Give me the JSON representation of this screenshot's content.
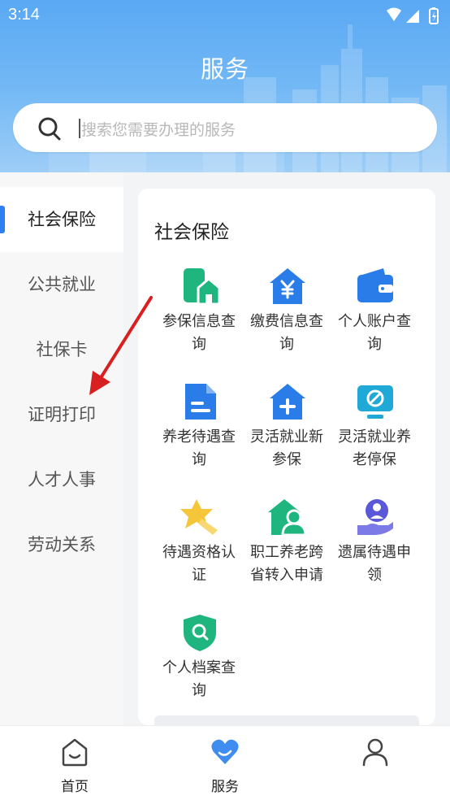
{
  "status_bar": {
    "time": "3:14"
  },
  "header": {
    "title": "服务"
  },
  "search": {
    "placeholder": "搜索您需要办理的服务"
  },
  "sidebar": {
    "items": [
      {
        "label": "社会保险",
        "active": true
      },
      {
        "label": "公共就业",
        "active": false
      },
      {
        "label": "社保卡",
        "active": false
      },
      {
        "label": "证明打印",
        "active": false
      },
      {
        "label": "人才人事",
        "active": false
      },
      {
        "label": "劳动关系",
        "active": false
      }
    ]
  },
  "content": {
    "section_title": "社会保险",
    "services": [
      {
        "line1": "参保信息查",
        "line2": "询",
        "icon": "phone-house-icon"
      },
      {
        "line1": "缴费信息查",
        "line2": "询",
        "icon": "yuan-house-icon"
      },
      {
        "line1": "个人账户查",
        "line2": "询",
        "icon": "wallet-icon"
      },
      {
        "line1": "养老待遇查",
        "line2": "询",
        "icon": "document-icon"
      },
      {
        "line1": "灵活就业新",
        "line2": "参保",
        "icon": "plus-house-icon"
      },
      {
        "line1": "灵活就业养",
        "line2": "老停保",
        "icon": "monitor-stop-icon"
      },
      {
        "line1": "待遇资格认",
        "line2": "证",
        "icon": "star-badge-icon"
      },
      {
        "line1": "职工养老跨",
        "line2": "省转入申请",
        "icon": "person-house-icon"
      },
      {
        "line1": "遗属待遇申",
        "line2": "领",
        "icon": "hand-person-icon"
      },
      {
        "line1": "个人档案查",
        "line2": "询",
        "icon": "shield-search-icon"
      }
    ]
  },
  "bottom_nav": {
    "items": [
      {
        "label": "首页",
        "icon": "home-icon"
      },
      {
        "label": "服务",
        "icon": "heart-icon",
        "active": true
      },
      {
        "label": "",
        "icon": "profile-icon"
      }
    ]
  },
  "colors": {
    "accent": "#2f7ef2",
    "green": "#1fb57f",
    "blue": "#2a7de9",
    "cyan": "#20a9d6",
    "yellow": "#f5c53a",
    "purple": "#5a57d9",
    "arrow_red": "#d82020"
  }
}
